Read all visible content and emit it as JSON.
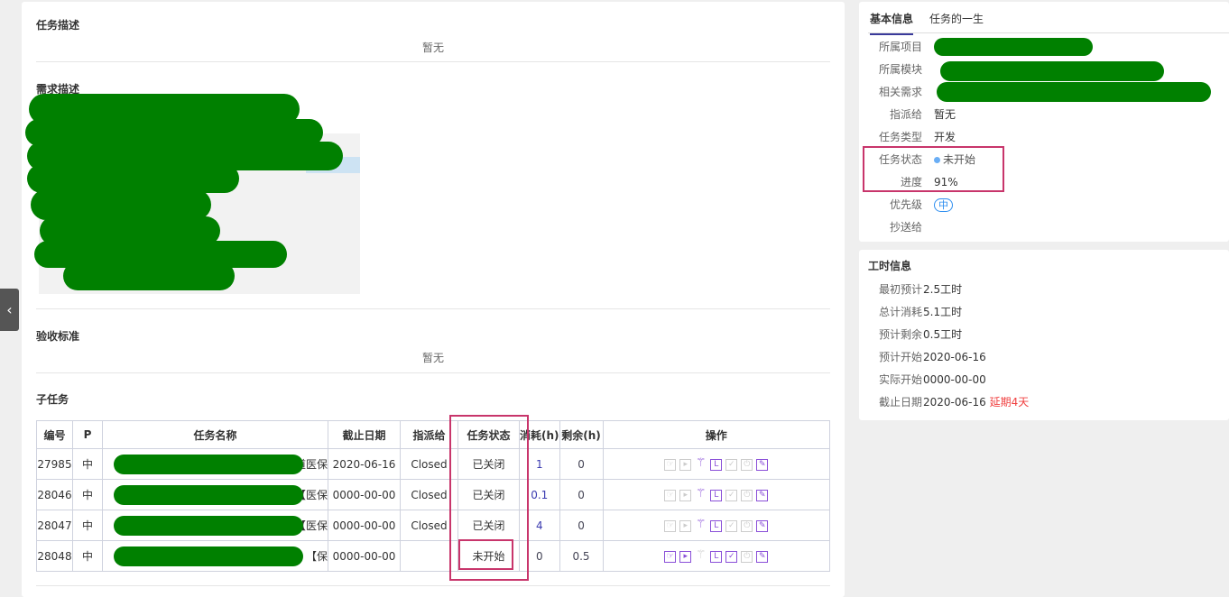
{
  "left": {
    "task_desc_title": "任务描述",
    "task_desc_value": "暂无",
    "req_desc_title": "需求描述",
    "accept_title": "验收标准",
    "accept_value": "暂无",
    "subtasks_title": "子任务",
    "table": {
      "headers": [
        "编号",
        "P",
        "任务名称",
        "截止日期",
        "指派给",
        "任务状态",
        "消耗(h)",
        "剩余(h)",
        "操作"
      ],
      "rows": [
        {
          "id": "27985",
          "p": "中",
          "name": "道医保",
          "deadline": "2020-06-16",
          "assignee": "Closed",
          "status": "已关闭",
          "used": "1",
          "left": "0"
        },
        {
          "id": "28046",
          "p": "中",
          "name": "【医保",
          "deadline": "0000-00-00",
          "assignee": "Closed",
          "status": "已关闭",
          "used": "0.1",
          "left": "0"
        },
        {
          "id": "28047",
          "p": "中",
          "name": "【医保",
          "deadline": "0000-00-00",
          "assignee": "Closed",
          "status": "已关闭",
          "used": "4",
          "left": "0"
        },
        {
          "id": "28048",
          "p": "中",
          "name": "【保",
          "deadline": "0000-00-00",
          "assignee": "",
          "status": "未开始",
          "used": "0",
          "left": "0.5"
        }
      ]
    }
  },
  "basic": {
    "tabs": [
      "基本信息",
      "任务的一生"
    ],
    "fields": [
      {
        "label": "所属项目",
        "value": ""
      },
      {
        "label": "所属模块",
        "value": ""
      },
      {
        "label": "相关需求",
        "value": ""
      },
      {
        "label": "指派给",
        "value": "暂无"
      },
      {
        "label": "任务类型",
        "value": "开发"
      },
      {
        "label": "任务状态",
        "value": "未开始"
      },
      {
        "label": "进度",
        "value": "91%"
      },
      {
        "label": "优先级",
        "value": "中"
      },
      {
        "label": "抄送给",
        "value": ""
      }
    ]
  },
  "hours": {
    "title": "工时信息",
    "fields": [
      {
        "label": "最初预计",
        "value": "2.5工时"
      },
      {
        "label": "总计消耗",
        "value": "5.1工时"
      },
      {
        "label": "预计剩余",
        "value": "0.5工时"
      },
      {
        "label": "预计开始",
        "value": "2020-06-16"
      },
      {
        "label": "实际开始",
        "value": "0000-00-00"
      },
      {
        "label": "截止日期",
        "value": "2020-06-16",
        "extra": "延期4天"
      }
    ]
  },
  "colors": {
    "accent": "#8a4fd8",
    "highlight": "#c8356b",
    "delay": "#f04040",
    "redaction": "#008000"
  }
}
